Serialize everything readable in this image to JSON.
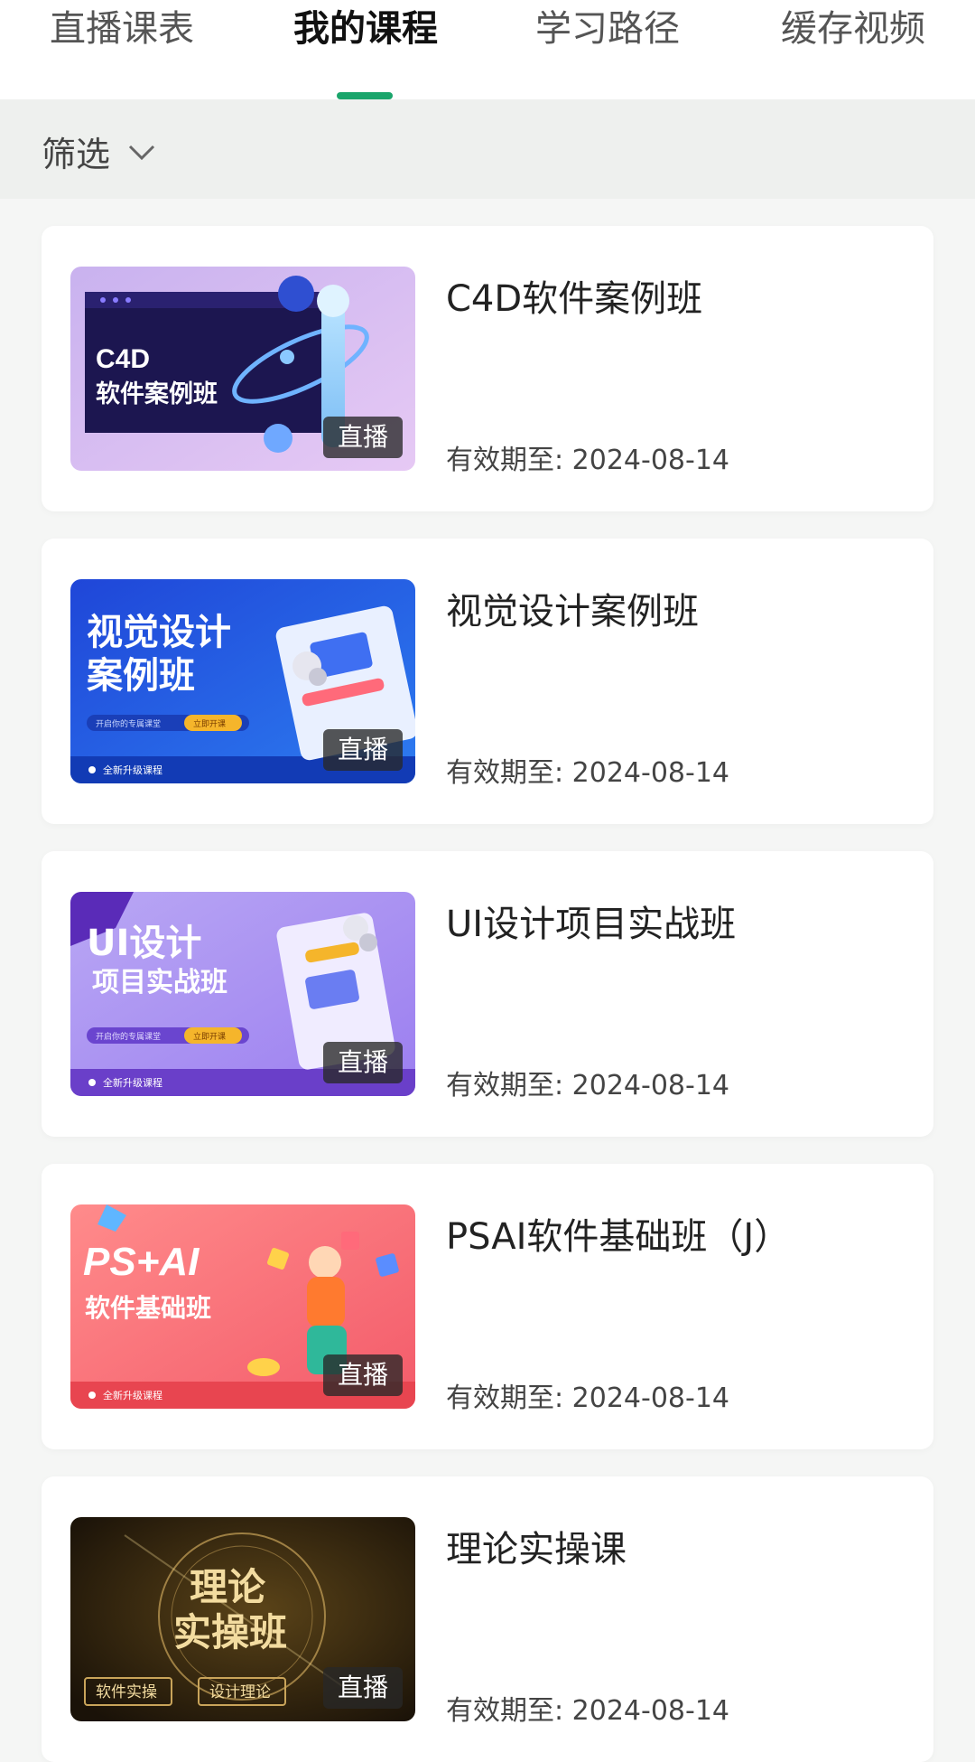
{
  "tabs": [
    {
      "label": "直播课表"
    },
    {
      "label": "我的课程"
    },
    {
      "label": "学习路径"
    },
    {
      "label": "缓存视频"
    }
  ],
  "filter": {
    "label": "筛选"
  },
  "colors": {
    "accent": "#1aa56b"
  },
  "courses": [
    {
      "title": "C4D软件案例班",
      "badge": "直播",
      "expiry_label": "有效期至:",
      "expiry_date": "2024-08-14",
      "thumb_lines": [
        "C4D",
        "软件案例班"
      ]
    },
    {
      "title": "视觉设计案例班",
      "badge": "直播",
      "expiry_label": "有效期至:",
      "expiry_date": "2024-08-14",
      "thumb_lines": [
        "视觉设计",
        "案例班"
      ],
      "thumb_sub": "开启你的专属课堂",
      "thumb_pill": "立即开课",
      "thumb_footer": "全新升级课程"
    },
    {
      "title": "UI设计项目实战班",
      "badge": "直播",
      "expiry_label": "有效期至:",
      "expiry_date": "2024-08-14",
      "thumb_lines": [
        "UI设计",
        "项目实战班"
      ],
      "thumb_sub": "开启你的专属课堂",
      "thumb_pill": "立即开课",
      "thumb_footer": "全新升级课程"
    },
    {
      "title": "PSAI软件基础班（J）",
      "badge": "直播",
      "expiry_label": "有效期至:",
      "expiry_date": "2024-08-14",
      "thumb_lines": [
        "PS+AI",
        "软件基础班"
      ],
      "thumb_footer": "全新升级课程"
    },
    {
      "title": "理论实操课",
      "badge": "直播",
      "expiry_label": "有效期至:",
      "expiry_date": "2024-08-14",
      "thumb_lines": [
        "理论",
        "实操班"
      ],
      "thumb_tags": [
        "软件实操",
        "设计理论"
      ]
    }
  ]
}
